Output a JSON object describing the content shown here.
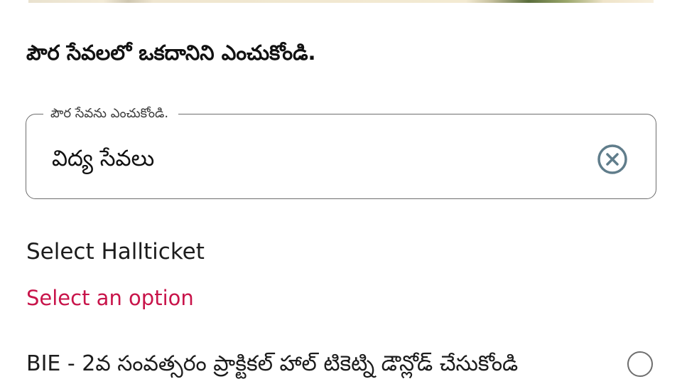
{
  "header": {
    "heading": "పౌర సేవలలో ఒకదానిని ఎంచుకోండి."
  },
  "service_field": {
    "label": "పౌర సేవను ఎంచుకోండి.",
    "value": "విద్య సేవలు",
    "clear_icon": "close-circle-icon",
    "accent_color": "#607d8b"
  },
  "hallticket": {
    "label": "Select Hallticket",
    "validation_message": "Select an option",
    "validation_color": "#c8144a",
    "options": [
      {
        "label": "BIE - 2వ సంవత్సరం ప్రాక్టికల్ హాల్ టికెట్ని డౌన్లోడ్ చేసుకోండి",
        "selected": false
      }
    ]
  }
}
